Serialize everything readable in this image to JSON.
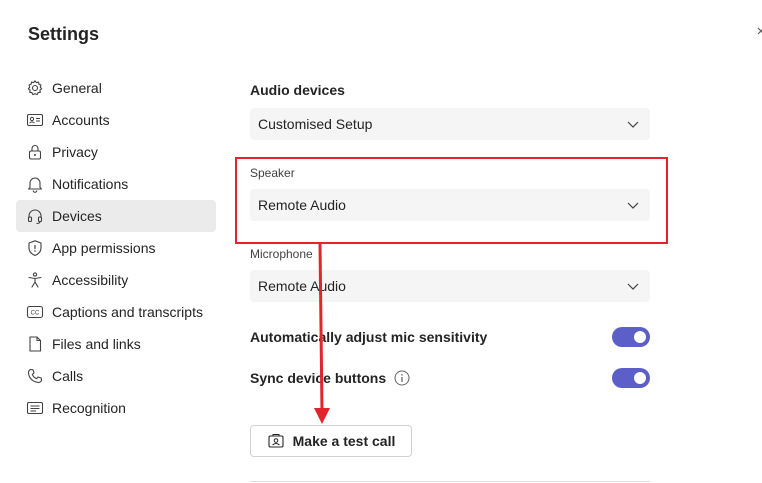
{
  "window": {
    "title": "Settings"
  },
  "sidebar": {
    "items": [
      {
        "label": "General",
        "icon": "gear-icon"
      },
      {
        "label": "Accounts",
        "icon": "id-card-icon"
      },
      {
        "label": "Privacy",
        "icon": "lock-icon"
      },
      {
        "label": "Notifications",
        "icon": "bell-icon"
      },
      {
        "label": "Devices",
        "icon": "headset-icon",
        "active": true
      },
      {
        "label": "App permissions",
        "icon": "shield-icon"
      },
      {
        "label": "Accessibility",
        "icon": "accessibility-icon"
      },
      {
        "label": "Captions and transcripts",
        "icon": "cc-icon"
      },
      {
        "label": "Files and links",
        "icon": "file-icon"
      },
      {
        "label": "Calls",
        "icon": "phone-icon"
      },
      {
        "label": "Recognition",
        "icon": "recognition-icon"
      }
    ]
  },
  "audio": {
    "section_title": "Audio devices",
    "setup_value": "Customised Setup",
    "speaker_label": "Speaker",
    "speaker_value": "Remote Audio",
    "microphone_label": "Microphone",
    "microphone_value": "Remote Audio"
  },
  "toggles": {
    "auto_adjust_label": "Automatically adjust mic sensitivity",
    "auto_adjust_on": true,
    "sync_buttons_label": "Sync device buttons",
    "sync_buttons_on": true
  },
  "test_call": {
    "label": "Make a test call"
  },
  "colors": {
    "accent": "#5b5fc7",
    "annotation": "#e0262c",
    "active_bg": "#ebebeb"
  }
}
